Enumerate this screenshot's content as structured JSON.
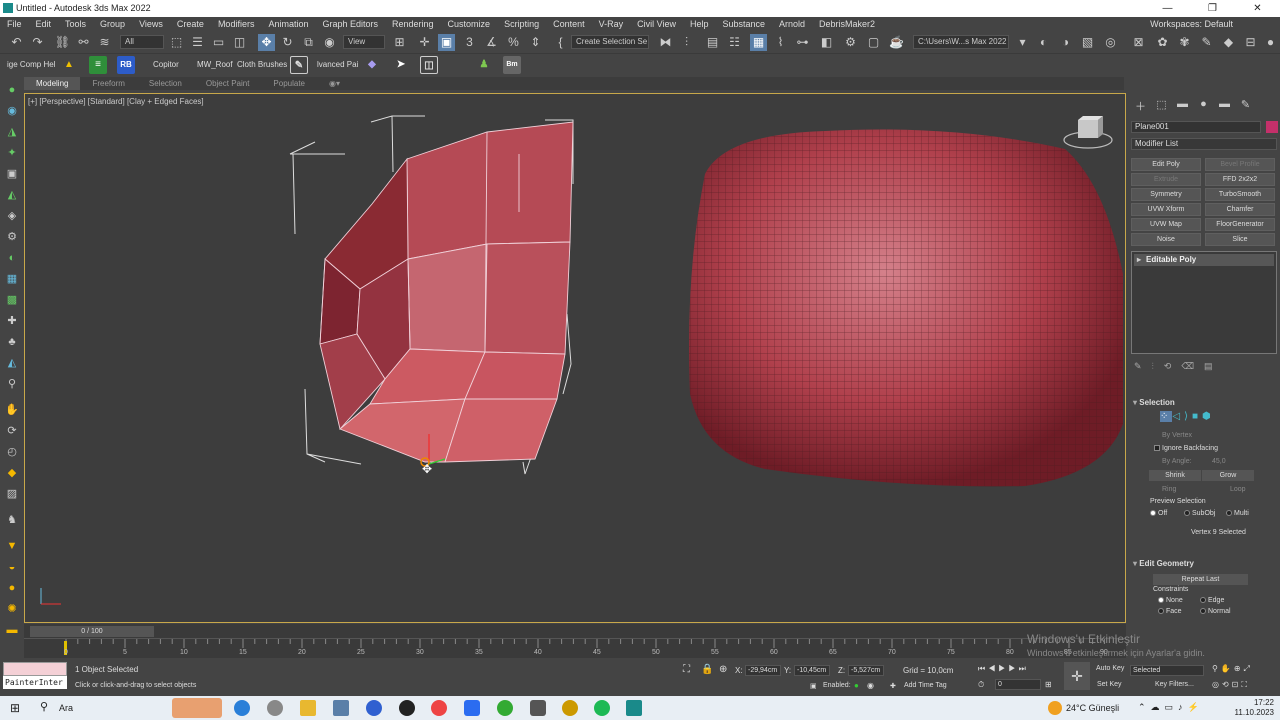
{
  "app": {
    "title": "Untitled - Autodesk 3ds Max 2022"
  },
  "window_controls": {
    "minimize": "—",
    "maximize": "❐",
    "close": "✕"
  },
  "menu": [
    "File",
    "Edit",
    "Tools",
    "Group",
    "Views",
    "Create",
    "Modifiers",
    "Animation",
    "Graph Editors",
    "Rendering",
    "Customize",
    "Scripting",
    "Content",
    "V-Ray",
    "Civil View",
    "Help",
    "Substance",
    "Arnold",
    "DebrisMaker2"
  ],
  "workspace": "Workspaces: Default",
  "toolbar1": {
    "selection_filter": "All",
    "ref_coord": "View",
    "named_selection": "Create Selection Se",
    "path": "C:\\Users\\W...s Max 2022"
  },
  "toolbar2": {
    "items": [
      "ige Comp Hel",
      "Copitor",
      "MW_Roof",
      "Cloth Brushes",
      "lvanced Pai"
    ],
    "rb": "RB",
    "bm": "Bm"
  },
  "ribbon": {
    "tabs": [
      "Modeling",
      "Freeform",
      "Selection",
      "Object Paint",
      "Populate"
    ]
  },
  "viewport": {
    "label": "[+] [Perspective] [Standard] [Clay + Edged Faces]"
  },
  "command_panel": {
    "object_name": "Plane001",
    "object_color": "#c4306a",
    "modifier_list": "Modifier List",
    "modifier_buttons": [
      {
        "label": "Edit Poly",
        "enabled": true
      },
      {
        "label": "Bevel Profile",
        "enabled": false
      },
      {
        "label": "Extrude",
        "enabled": false
      },
      {
        "label": "FFD 2x2x2",
        "enabled": true
      },
      {
        "label": "Symmetry",
        "enabled": true
      },
      {
        "label": "TurboSmooth",
        "enabled": true
      },
      {
        "label": "UVW Xform",
        "enabled": true
      },
      {
        "label": "Chamfer",
        "enabled": true
      },
      {
        "label": "UVW Map",
        "enabled": true
      },
      {
        "label": "FloorGenerator",
        "enabled": true
      },
      {
        "label": "Noise",
        "enabled": true
      },
      {
        "label": "Slice",
        "enabled": true
      }
    ],
    "stack_item": "Editable Poly",
    "selection": {
      "title": "Selection",
      "by_vertex": "By Vertex",
      "ignore_backfacing": "Ignore Backfacing",
      "by_angle": "By Angle:",
      "angle_value": "45,0",
      "shrink": "Shrink",
      "grow": "Grow",
      "ring": "Ring",
      "loop": "Loop",
      "preview_selection": "Preview Selection",
      "preview_options": [
        "Off",
        "SubObj",
        "Multi"
      ],
      "status": "Vertex 9 Selected"
    },
    "edit_geometry": {
      "title": "Edit Geometry",
      "repeat_last": "Repeat Last",
      "constraints": "Constraints",
      "options": [
        "None",
        "Edge",
        "Face",
        "Normal"
      ]
    }
  },
  "timeline": {
    "frame": "0 / 100",
    "ticks": [
      "0",
      "5",
      "10",
      "15",
      "20",
      "25",
      "30",
      "35",
      "40",
      "45",
      "50",
      "55",
      "60",
      "65",
      "70",
      "75",
      "80",
      "85",
      "90",
      "95",
      "100"
    ]
  },
  "status": {
    "maxscript": "",
    "painter": "PainterInter",
    "selected": "1 Object Selected",
    "prompt": "Click or click-and-drag to select objects",
    "x": "-29,94cm",
    "y": "-10,45cm",
    "z": "-5,527cm",
    "grid": "Grid = 10,0cm",
    "enabled": "Enabled:",
    "add_time_tag": "Add Time Tag",
    "auto_key": "Auto Key",
    "set_key": "Set Key",
    "selected_dd": "Selected",
    "key_filters": "Key Filters...",
    "frame_field": "0"
  },
  "watermark": {
    "line1": "Windows'u Etkinleştir",
    "line2": "Windows'u etkinleştirmek için Ayarlar'a gidin."
  },
  "taskbar": {
    "search": "Ara",
    "weather": "24°C Güneşli",
    "time": "17:22",
    "date": "11.10.2023"
  }
}
